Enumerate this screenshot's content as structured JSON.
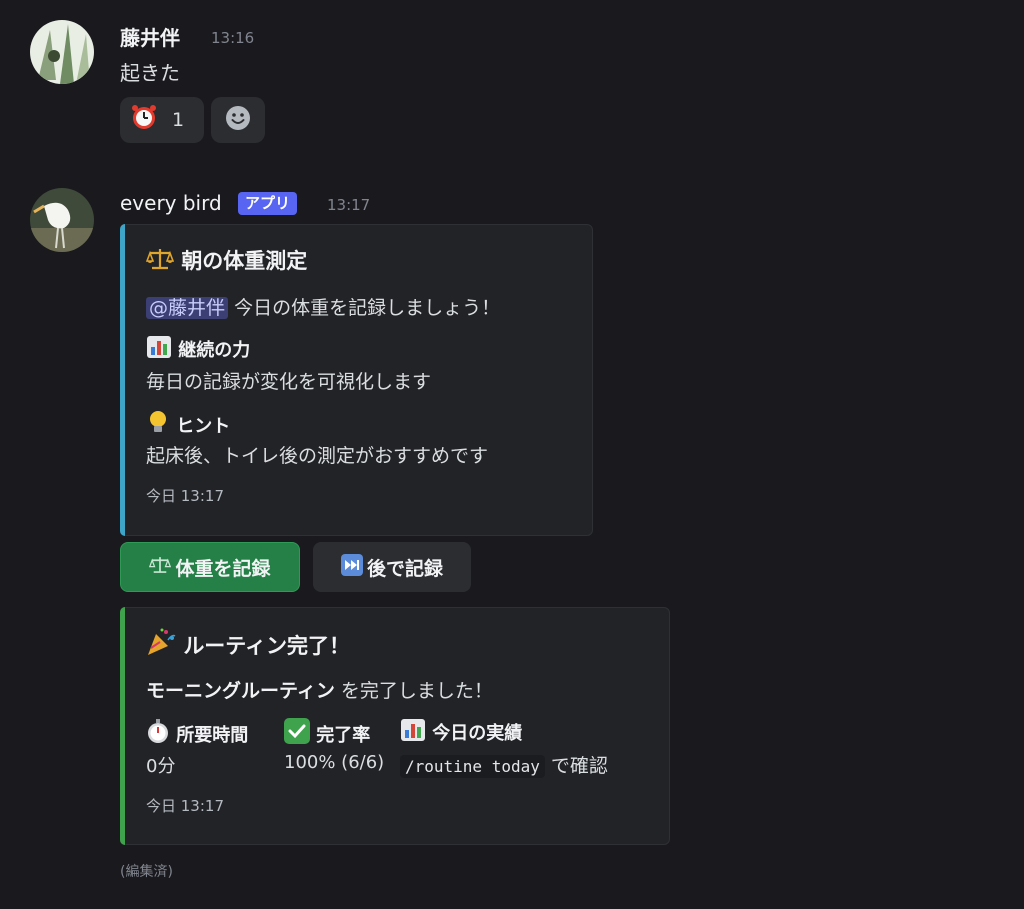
{
  "message1": {
    "author": "藤井伴",
    "time": "13:16",
    "text": "起きた",
    "reaction": {
      "emoji": "alarm-clock",
      "count": "1"
    }
  },
  "message2": {
    "author": "every bird",
    "badge": "アプリ",
    "time": "13:17",
    "embed1": {
      "accent": "#3ea5c9",
      "title_icon": "balance-scale",
      "title": "朝の体重測定",
      "mention": "@藤井伴",
      "desc": "今日の体重を記録しましょう！",
      "field1_name": "継続の力",
      "field1_value": "毎日の記録が変化を可視化します",
      "field2_name": "ヒント",
      "field2_value": "起床後、トイレ後の測定がおすすめです",
      "footer": "今日 13:17"
    },
    "buttons": {
      "record": "体重を記録",
      "later": "後で記録"
    },
    "embed2": {
      "accent": "#3fa34d",
      "title": "ルーティン完了！",
      "bold_text": "モーニングルーティン",
      "text_rest": " を完了しました！",
      "field1_name": "所要時間",
      "field1_value": "0分",
      "field2_name": "完了率",
      "field2_value": "100% (6/6)",
      "field3_name": "今日の実績",
      "field3_code": "/routine today",
      "field3_suffix": " で確認",
      "footer": "今日 13:17"
    },
    "edited": "(編集済)"
  }
}
